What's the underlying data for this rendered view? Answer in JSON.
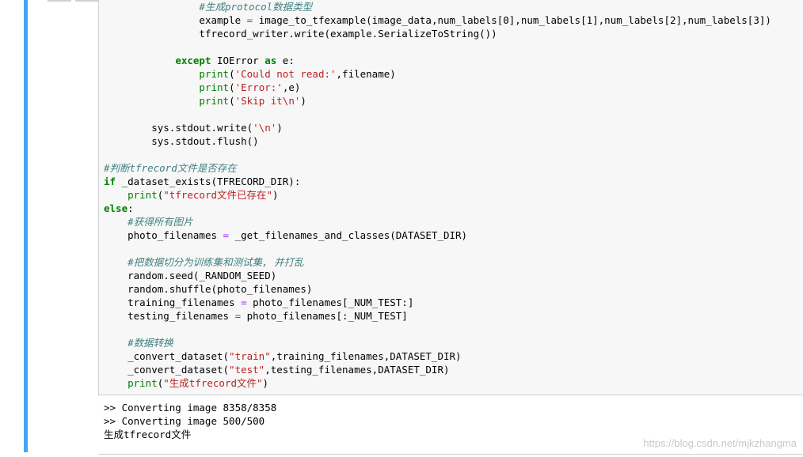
{
  "code_lines": [
    {
      "indent": "                ",
      "tokens": [
        {
          "t": "#生成protocol数据类型",
          "c": "cm"
        }
      ]
    },
    {
      "indent": "                ",
      "tokens": [
        {
          "t": "example ",
          "c": ""
        },
        {
          "t": "=",
          "c": "op"
        },
        {
          "t": " image_to_tfexample(image_data,num_labels[0],num_labels[1],num_labels[2],num_labels[3])",
          "c": ""
        }
      ]
    },
    {
      "indent": "                ",
      "tokens": [
        {
          "t": "tfrecord_writer.write(example.SerializeToString())",
          "c": ""
        }
      ]
    },
    {
      "indent": "",
      "tokens": []
    },
    {
      "indent": "            ",
      "tokens": [
        {
          "t": "except",
          "c": "kw"
        },
        {
          "t": " IOError ",
          "c": ""
        },
        {
          "t": "as",
          "c": "kw"
        },
        {
          "t": " e:",
          "c": ""
        }
      ]
    },
    {
      "indent": "                ",
      "tokens": [
        {
          "t": "print",
          "c": "bi"
        },
        {
          "t": "(",
          "c": ""
        },
        {
          "t": "'Could not read:'",
          "c": "str"
        },
        {
          "t": ",filename)",
          "c": ""
        }
      ]
    },
    {
      "indent": "                ",
      "tokens": [
        {
          "t": "print",
          "c": "bi"
        },
        {
          "t": "(",
          "c": ""
        },
        {
          "t": "'Error:'",
          "c": "str"
        },
        {
          "t": ",e)",
          "c": ""
        }
      ]
    },
    {
      "indent": "                ",
      "tokens": [
        {
          "t": "print",
          "c": "bi"
        },
        {
          "t": "(",
          "c": ""
        },
        {
          "t": "'Skip it\\n'",
          "c": "str"
        },
        {
          "t": ")",
          "c": ""
        }
      ]
    },
    {
      "indent": "",
      "tokens": []
    },
    {
      "indent": "        ",
      "tokens": [
        {
          "t": "sys.stdout.write(",
          "c": ""
        },
        {
          "t": "'\\n'",
          "c": "str"
        },
        {
          "t": ")",
          "c": ""
        }
      ]
    },
    {
      "indent": "        ",
      "tokens": [
        {
          "t": "sys.stdout.flush()",
          "c": ""
        }
      ]
    },
    {
      "indent": "",
      "tokens": []
    },
    {
      "indent": "",
      "tokens": [
        {
          "t": "#判断tfrecord文件是否存在",
          "c": "cm"
        }
      ]
    },
    {
      "indent": "",
      "tokens": [
        {
          "t": "if",
          "c": "kw"
        },
        {
          "t": " _dataset_exists(TFRECORD_DIR):",
          "c": ""
        }
      ]
    },
    {
      "indent": "    ",
      "tokens": [
        {
          "t": "print",
          "c": "bi"
        },
        {
          "t": "(",
          "c": ""
        },
        {
          "t": "\"tfrecord文件已存在\"",
          "c": "str"
        },
        {
          "t": ")",
          "c": ""
        }
      ]
    },
    {
      "indent": "",
      "tokens": [
        {
          "t": "else",
          "c": "kw"
        },
        {
          "t": ":",
          "c": ""
        }
      ]
    },
    {
      "indent": "    ",
      "tokens": [
        {
          "t": "#获得所有图片",
          "c": "cm"
        }
      ]
    },
    {
      "indent": "    ",
      "tokens": [
        {
          "t": "photo_filenames ",
          "c": ""
        },
        {
          "t": "=",
          "c": "op"
        },
        {
          "t": " _get_filenames_and_classes(DATASET_DIR)",
          "c": ""
        }
      ]
    },
    {
      "indent": "",
      "tokens": []
    },
    {
      "indent": "    ",
      "tokens": [
        {
          "t": "#把数据切分为训练集和测试集, 并打乱",
          "c": "cm"
        }
      ]
    },
    {
      "indent": "    ",
      "tokens": [
        {
          "t": "random.seed(_RANDOM_SEED)",
          "c": ""
        }
      ]
    },
    {
      "indent": "    ",
      "tokens": [
        {
          "t": "random.shuffle(photo_filenames)",
          "c": ""
        }
      ]
    },
    {
      "indent": "    ",
      "tokens": [
        {
          "t": "training_filenames ",
          "c": ""
        },
        {
          "t": "=",
          "c": "op"
        },
        {
          "t": " photo_filenames[_NUM_TEST:]",
          "c": ""
        }
      ]
    },
    {
      "indent": "    ",
      "tokens": [
        {
          "t": "testing_filenames ",
          "c": ""
        },
        {
          "t": "=",
          "c": "op"
        },
        {
          "t": " photo_filenames[:_NUM_TEST]",
          "c": ""
        }
      ]
    },
    {
      "indent": "",
      "tokens": []
    },
    {
      "indent": "    ",
      "tokens": [
        {
          "t": "#数据转换",
          "c": "cm"
        }
      ]
    },
    {
      "indent": "    ",
      "tokens": [
        {
          "t": "_convert_dataset(",
          "c": ""
        },
        {
          "t": "\"train\"",
          "c": "str"
        },
        {
          "t": ",training_filenames,DATASET_DIR)",
          "c": ""
        }
      ]
    },
    {
      "indent": "    ",
      "tokens": [
        {
          "t": "_convert_dataset(",
          "c": ""
        },
        {
          "t": "\"test\"",
          "c": "str"
        },
        {
          "t": ",testing_filenames,DATASET_DIR)",
          "c": ""
        }
      ]
    },
    {
      "indent": "    ",
      "tokens": [
        {
          "t": "print",
          "c": "bi"
        },
        {
          "t": "(",
          "c": ""
        },
        {
          "t": "\"生成tfrecord文件\"",
          "c": "str"
        },
        {
          "t": ")",
          "c": ""
        }
      ]
    }
  ],
  "output_lines": [
    ">> Converting image 8358/8358",
    ">> Converting image 500/500",
    "生成tfrecord文件"
  ],
  "watermark": "https://blog.csdn.net/mjkzhangma",
  "colors": {
    "cell_accent": "#42a5f5",
    "keyword": "#008000",
    "string": "#ba2121",
    "comment": "#408080",
    "operator": "#aa22ff"
  }
}
